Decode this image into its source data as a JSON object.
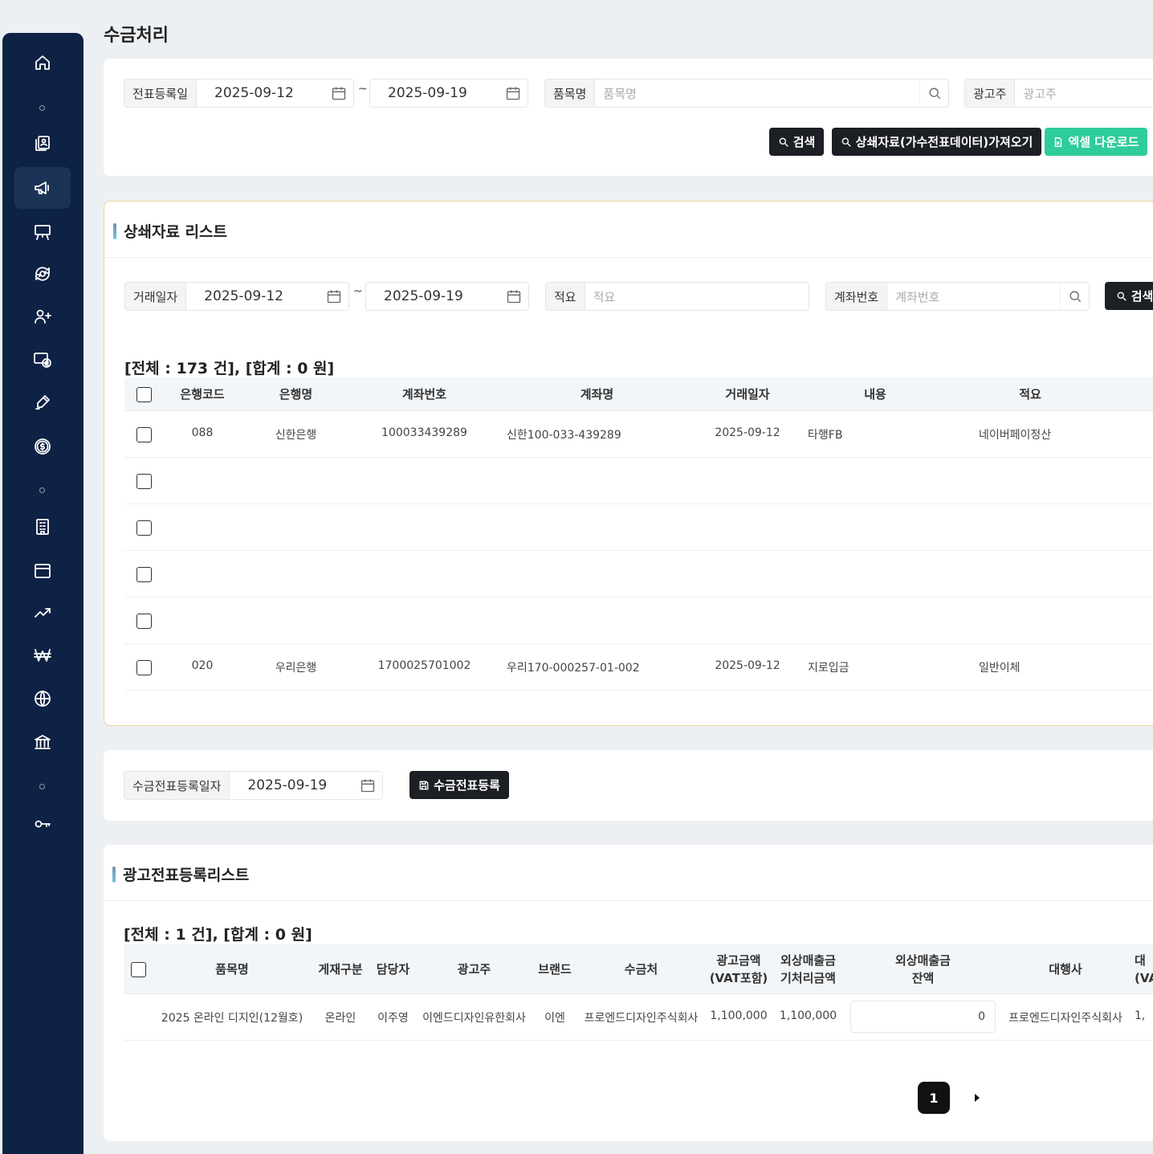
{
  "page": {
    "title": "수금처리"
  },
  "sidebar": {
    "items": [
      {
        "icon": "home-icon",
        "name": "sidebar-item-home"
      },
      {
        "icon": "contacts-icon",
        "name": "sidebar-item-contacts"
      },
      {
        "icon": "megaphone-icon",
        "name": "sidebar-item-advertising",
        "active": true
      },
      {
        "icon": "easel-icon",
        "name": "sidebar-item-presentation"
      },
      {
        "icon": "target-refresh-icon",
        "name": "sidebar-item-cycle"
      },
      {
        "icon": "user-plus-icon",
        "name": "sidebar-item-add-user"
      },
      {
        "icon": "money-monitor-icon",
        "name": "sidebar-item-billing"
      },
      {
        "icon": "pen-icon",
        "name": "sidebar-item-write"
      },
      {
        "icon": "dollar-circle-icon",
        "name": "sidebar-item-payment"
      },
      {
        "icon": "building-icon",
        "name": "sidebar-item-company"
      },
      {
        "icon": "window-icon",
        "name": "sidebar-item-window"
      },
      {
        "icon": "trend-up-icon",
        "name": "sidebar-item-trend"
      },
      {
        "icon": "won-icon",
        "name": "sidebar-item-won"
      },
      {
        "icon": "globe-icon",
        "name": "sidebar-item-globe"
      },
      {
        "icon": "bank-icon",
        "name": "sidebar-item-bank"
      },
      {
        "icon": "key-icon",
        "name": "sidebar-item-key"
      }
    ]
  },
  "filters": {
    "date_label": "전표등록일",
    "date_from": "2025-09-12",
    "date_to": "2025-09-19",
    "tilde": "~",
    "item_label": "품목명",
    "item_placeholder": "품목명",
    "advertiser_label": "광고주",
    "advertiser_placeholder": "광고주",
    "search_button": "검색",
    "import_button": "상쇄자료(가수전표데이터)가져오기",
    "excel_button": "엑셀 다운로드"
  },
  "offset_list": {
    "title": "상쇄자료 리스트",
    "filters": {
      "date_label": "거래일자",
      "date_from": "2025-09-12",
      "date_to": "2025-09-19",
      "tilde": "~",
      "memo_label": "적요",
      "memo_placeholder": "적요",
      "account_label": "계좌번호",
      "account_placeholder": "계좌번호",
      "search_button": "검색"
    },
    "summary": "[전체 : 173 건], [합계 : 0 원]",
    "columns": [
      "은행코드",
      "은행명",
      "계좌번호",
      "계좌명",
      "거래일자",
      "내용",
      "적요"
    ],
    "rows": [
      {
        "bank_code": "088",
        "bank_name": "신한은행",
        "account_no": "100033439289",
        "account_name": "신한100-033-439289",
        "date": "2025-09-12",
        "content": "타행FB",
        "memo": "네이버페이정산"
      },
      {
        "bank_code": "",
        "bank_name": "",
        "account_no": "",
        "account_name": "",
        "date": "",
        "content": "",
        "memo": ""
      },
      {
        "bank_code": "",
        "bank_name": "",
        "account_no": "",
        "account_name": "",
        "date": "",
        "content": "",
        "memo": ""
      },
      {
        "bank_code": "",
        "bank_name": "",
        "account_no": "",
        "account_name": "",
        "date": "",
        "content": "",
        "memo": ""
      },
      {
        "bank_code": "",
        "bank_name": "",
        "account_no": "",
        "account_name": "",
        "date": "",
        "content": "",
        "memo": ""
      },
      {
        "bank_code": "020",
        "bank_name": "우리은행",
        "account_no": "1700025701002",
        "account_name": "우리170-000257-01-002",
        "date": "2025-09-12",
        "content": "지로입금",
        "memo": "일반이체"
      }
    ]
  },
  "register": {
    "date_label": "수금전표등록일자",
    "date_value": "2025-09-19",
    "button": "수금전표등록"
  },
  "ad_list": {
    "title": "광고전표등록리스트",
    "summary": "[전체 : 1 건], [합계 : 0 원]",
    "columns": {
      "item": "품목명",
      "type": "게재구분",
      "manager": "담당자",
      "advertiser": "광고주",
      "brand": "브랜드",
      "collector": "수금처",
      "amount": "광고금액\n(VAT포함)",
      "processed": "외상매출금\n기처리금액",
      "balance": "외상매출금\n잔액",
      "agency": "대행사",
      "partial": "대\n(VA"
    },
    "rows": [
      {
        "item": "2025 온라인 디지인(12월호)",
        "type": "온라인",
        "manager": "이주영",
        "advertiser": "이엔드디자인유한회사",
        "brand": "이엔",
        "collector": "프로엔드디자인주식회사",
        "amount": "1,100,000",
        "processed": "1,100,000",
        "balance": "0",
        "agency": "프로엔드디자인주식회사",
        "partial": "1,"
      }
    ]
  },
  "pagination": {
    "current": "1"
  }
}
